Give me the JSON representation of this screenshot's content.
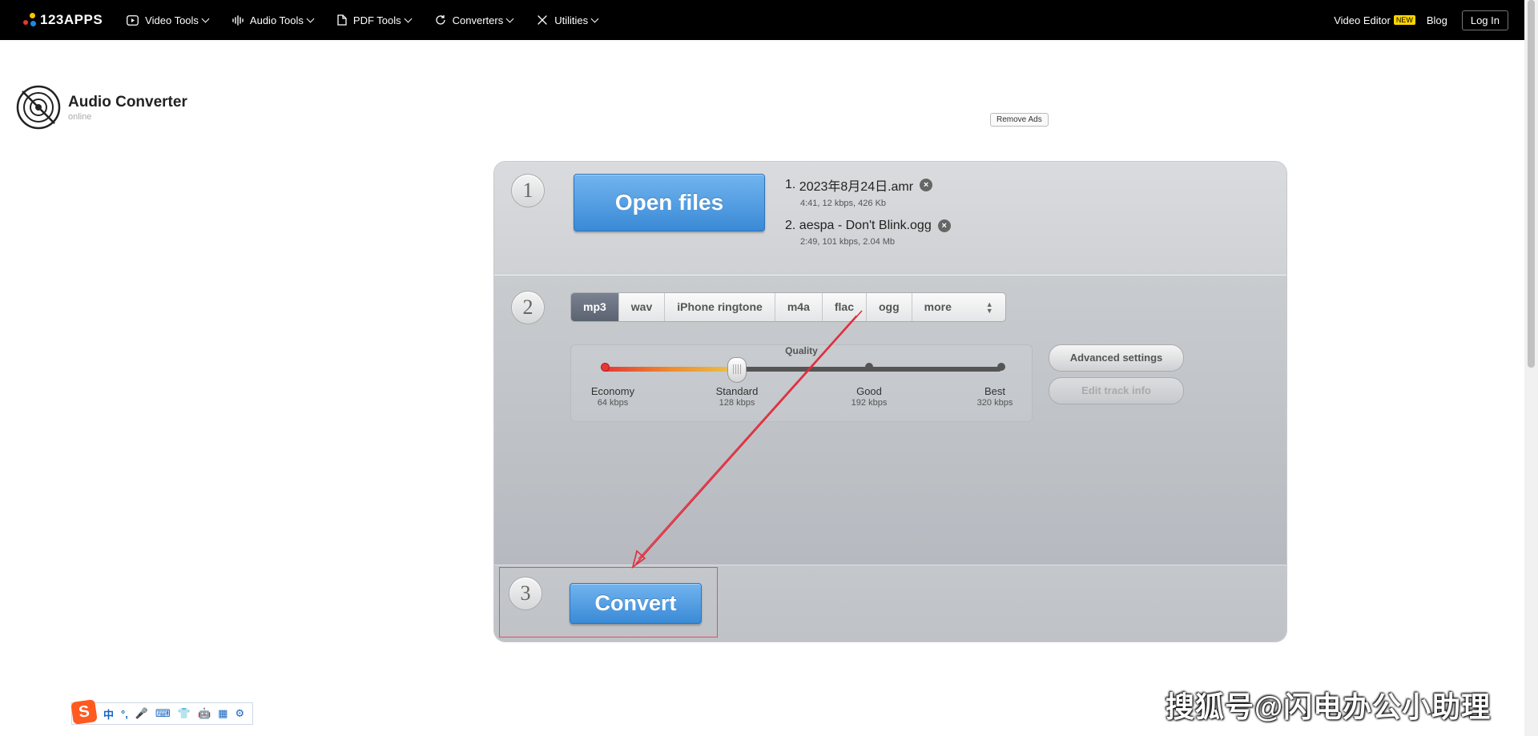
{
  "nav": {
    "logo": "123APPS",
    "items": [
      {
        "label": "Video Tools",
        "icon": "play-icon"
      },
      {
        "label": "Audio Tools",
        "icon": "waveform-icon"
      },
      {
        "label": "PDF Tools",
        "icon": "document-icon"
      },
      {
        "label": "Converters",
        "icon": "refresh-icon"
      },
      {
        "label": "Utilities",
        "icon": "tools-icon"
      }
    ],
    "video_editor": "Video Editor",
    "new_badge": "NEW",
    "blog": "Blog",
    "login": "Log In"
  },
  "header": {
    "title": "Audio Converter",
    "subtitle": "online",
    "remove_ads": "Remove Ads"
  },
  "step1": {
    "number": "1",
    "open_label": "Open files",
    "files": [
      {
        "index": "1.",
        "name": "2023年8月24日.amr",
        "meta": "4:41, 12 kbps, 426 Kb"
      },
      {
        "index": "2.",
        "name": "aespa - Don't Blink.ogg",
        "meta": "2:49, 101 kbps, 2.04 Mb"
      }
    ]
  },
  "step2": {
    "number": "2",
    "formats": [
      "mp3",
      "wav",
      "iPhone ringtone",
      "m4a",
      "flac",
      "ogg"
    ],
    "selected_format": "mp3",
    "more_label": "more",
    "quality_label": "Quality",
    "quality_options": [
      {
        "name": "Economy",
        "kbps": "64 kbps"
      },
      {
        "name": "Standard",
        "kbps": "128 kbps"
      },
      {
        "name": "Good",
        "kbps": "192 kbps"
      },
      {
        "name": "Best",
        "kbps": "320 kbps"
      }
    ],
    "quality_selected_index": 1,
    "advanced_label": "Advanced settings",
    "edit_track_label": "Edit track info"
  },
  "step3": {
    "number": "3",
    "convert_label": "Convert"
  },
  "annotation_color": "#e02b3c",
  "ime": {
    "logo": "S",
    "icons": [
      "中",
      "°,",
      "🎤",
      "⌨",
      "👕",
      "🤖",
      "▦",
      "⚙"
    ]
  },
  "watermark": "搜狐号@闪电办公小助理"
}
